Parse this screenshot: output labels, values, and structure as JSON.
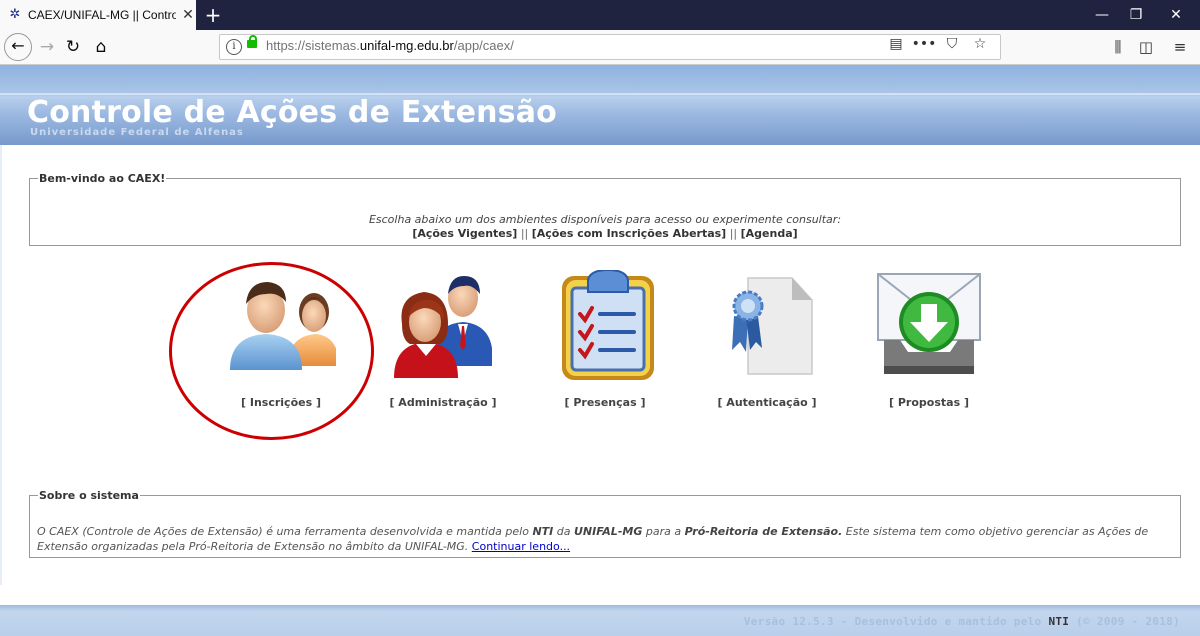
{
  "browser": {
    "tab_title": "CAEX/UNIFAL-MG || Controle de",
    "url_prefix": "https://sistemas.",
    "url_domain": "unifal-mg.edu.br",
    "url_path": "/app/caex/"
  },
  "header": {
    "title": "Controle de Ações de Extensão",
    "subtitle": "Universidade Federal de Alfenas"
  },
  "welcome": {
    "legend": "Bem-vindo ao CAEX!",
    "text": "Escolha abaixo um dos ambientes disponíveis para acesso ou experimente consultar:",
    "links": [
      "[Ações Vigentes]",
      "[Ações com Inscrições Abertas]",
      "[Agenda]"
    ],
    "separator": "||"
  },
  "environments": [
    {
      "label": "[ Inscrições ]",
      "icon": "users-icon"
    },
    {
      "label": "[ Administração ]",
      "icon": "admin-icon"
    },
    {
      "label": "[ Presenças ]",
      "icon": "checklist-icon"
    },
    {
      "label": "[ Autenticação ]",
      "icon": "certificate-icon"
    },
    {
      "label": "[ Propostas ]",
      "icon": "inbox-icon"
    }
  ],
  "about": {
    "legend": "Sobre o sistema",
    "p1": "O CAEX (Controle de Ações de Extensão) é uma ferramenta desenvolvida e mantida pelo ",
    "nti": "NTI",
    "p2": " da ",
    "unifal": "UNIFAL-MG",
    "p3": " para a ",
    "proreitoria": "Pró-Reitoria de Extensão.",
    "p4": " Este sistema tem como objetivo gerenciar as Ações de Extensão organizadas pela Pró-Reitoria de Extensão no âmbito da UNIFAL-MG. ",
    "link": "Continuar lendo..."
  },
  "footer": {
    "pre": "Versão 12.5.3 - Desenvolvido e mantido pelo ",
    "nti": "NTI",
    "post": " (© 2009 - 2018)"
  },
  "colors": {
    "banner": "#7799cb",
    "highlight": "#cc0000",
    "link": "#0000cc"
  }
}
